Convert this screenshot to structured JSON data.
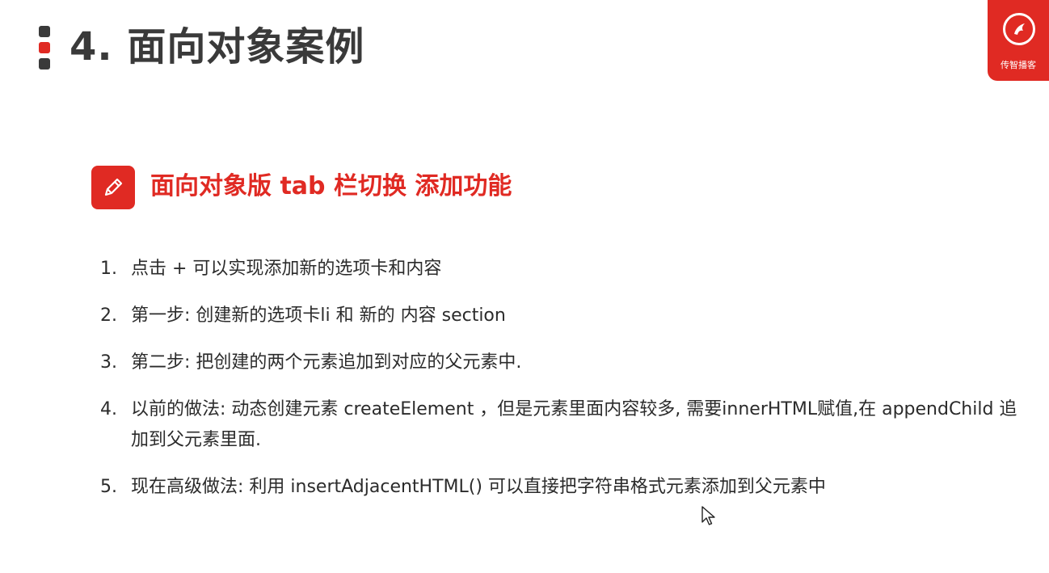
{
  "header": {
    "title": "4. 面向对象案例"
  },
  "logo": {
    "text": "传智播客",
    "icon": "dragon-logo-icon",
    "color": "#e02a23"
  },
  "section": {
    "icon": "pencil-icon",
    "title": "面向对象版 tab 栏切换 添加功能"
  },
  "steps": [
    {
      "num": "1.",
      "text": "点击 + 可以实现添加新的选项卡和内容"
    },
    {
      "num": "2.",
      "text": "第一步: 创建新的选项卡li 和 新的 内容 section"
    },
    {
      "num": "3.",
      "text": "第二步: 把创建的两个元素追加到对应的父元素中."
    },
    {
      "num": "4.",
      "text": "以前的做法:  动态创建元素 createElement ，但是元素里面内容较多, 需要innerHTML赋值,在 appendChild 追加到父元素里面."
    },
    {
      "num": "5.",
      "text": "现在高级做法:   利用 insertAdjacentHTML() 可以直接把字符串格式元素添加到父元素中"
    }
  ],
  "colors": {
    "accent": "#e02a23",
    "title": "#3a3a3a",
    "body": "#2b2b2b"
  }
}
